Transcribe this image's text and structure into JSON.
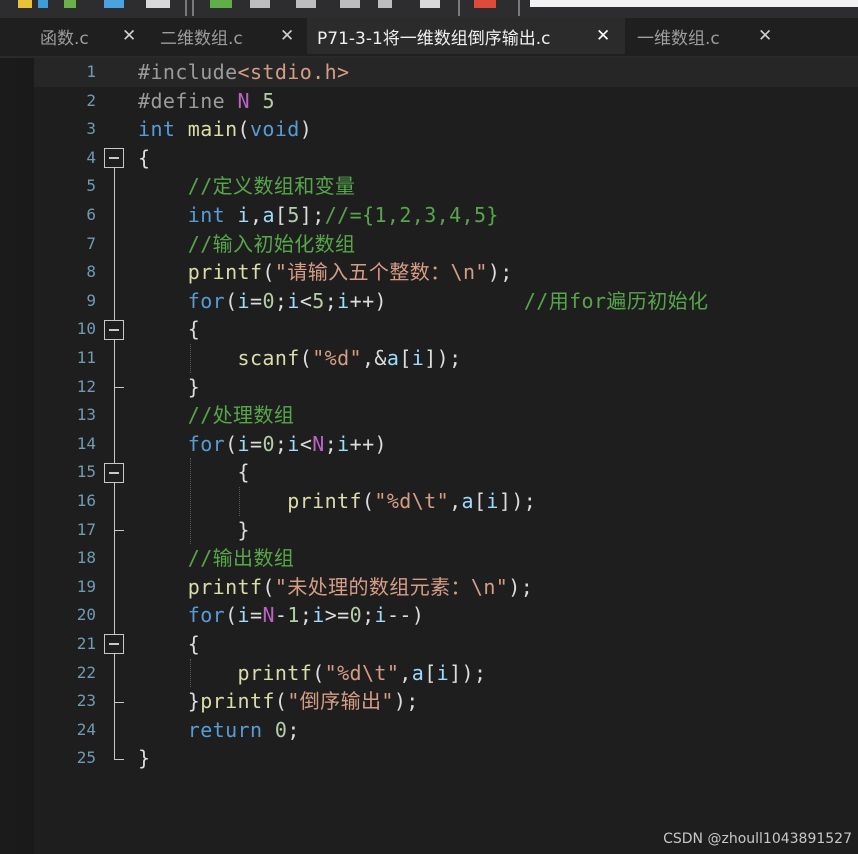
{
  "tabs": [
    {
      "label": "函数.c",
      "close": "✕"
    },
    {
      "label": "二维数组.c",
      "close": "✕"
    },
    {
      "label": "P71-3-1将一维数组倒序输出.c",
      "close": "✕"
    },
    {
      "label": "一维数组.c",
      "close": "✕"
    }
  ],
  "active_tab": 2,
  "code_lines": [
    [
      [
        "pp",
        "#include"
      ],
      [
        "str",
        "<stdio.h>"
      ]
    ],
    [
      [
        "pp",
        "#define "
      ],
      [
        "mac",
        "N"
      ],
      [
        "plain",
        " "
      ],
      [
        "num",
        "5"
      ]
    ],
    [
      [
        "kw",
        "int "
      ],
      [
        "fn",
        "main"
      ],
      [
        "plain",
        "("
      ],
      [
        "kw",
        "void"
      ],
      [
        "plain",
        ")"
      ]
    ],
    [
      [
        "plain",
        "{"
      ]
    ],
    [
      [
        "plain",
        "    "
      ],
      [
        "cmt",
        "//定义数组和变量"
      ]
    ],
    [
      [
        "plain",
        "    "
      ],
      [
        "kw",
        "int "
      ],
      [
        "var",
        "i"
      ],
      [
        "plain",
        ","
      ],
      [
        "var",
        "a"
      ],
      [
        "plain",
        "["
      ],
      [
        "num",
        "5"
      ],
      [
        "plain",
        "];"
      ],
      [
        "cmt",
        "//={1,2,3,4,5}"
      ]
    ],
    [
      [
        "plain",
        "    "
      ],
      [
        "cmt",
        "//输入初始化数组"
      ]
    ],
    [
      [
        "plain",
        "    "
      ],
      [
        "fn",
        "printf"
      ],
      [
        "plain",
        "("
      ],
      [
        "str",
        "\"请输入五个整数：\\n\""
      ],
      [
        "plain",
        ");"
      ]
    ],
    [
      [
        "plain",
        "    "
      ],
      [
        "kw",
        "for"
      ],
      [
        "plain",
        "("
      ],
      [
        "var",
        "i"
      ],
      [
        "plain",
        "="
      ],
      [
        "num",
        "0"
      ],
      [
        "plain",
        ";"
      ],
      [
        "var",
        "i"
      ],
      [
        "plain",
        "<"
      ],
      [
        "num",
        "5"
      ],
      [
        "plain",
        ";"
      ],
      [
        "var",
        "i"
      ],
      [
        "plain",
        "++)           "
      ],
      [
        "cmt",
        "//用for遍历初始化"
      ]
    ],
    [
      [
        "plain",
        "    {"
      ]
    ],
    [
      [
        "plain",
        "        "
      ],
      [
        "fn",
        "scanf"
      ],
      [
        "plain",
        "("
      ],
      [
        "str",
        "\"%d\""
      ],
      [
        "plain",
        ",&"
      ],
      [
        "var",
        "a"
      ],
      [
        "plain",
        "["
      ],
      [
        "var",
        "i"
      ],
      [
        "plain",
        "]);"
      ]
    ],
    [
      [
        "plain",
        "    }"
      ]
    ],
    [
      [
        "plain",
        "    "
      ],
      [
        "cmt",
        "//处理数组"
      ]
    ],
    [
      [
        "plain",
        "    "
      ],
      [
        "kw",
        "for"
      ],
      [
        "plain",
        "("
      ],
      [
        "var",
        "i"
      ],
      [
        "plain",
        "="
      ],
      [
        "num",
        "0"
      ],
      [
        "plain",
        ";"
      ],
      [
        "var",
        "i"
      ],
      [
        "plain",
        "<"
      ],
      [
        "mac",
        "N"
      ],
      [
        "plain",
        ";"
      ],
      [
        "var",
        "i"
      ],
      [
        "plain",
        "++)"
      ]
    ],
    [
      [
        "plain",
        "        {"
      ]
    ],
    [
      [
        "plain",
        "            "
      ],
      [
        "fn",
        "printf"
      ],
      [
        "plain",
        "("
      ],
      [
        "str",
        "\"%d\\t\""
      ],
      [
        "plain",
        ","
      ],
      [
        "var",
        "a"
      ],
      [
        "plain",
        "["
      ],
      [
        "var",
        "i"
      ],
      [
        "plain",
        "]);"
      ]
    ],
    [
      [
        "plain",
        "        }"
      ]
    ],
    [
      [
        "plain",
        "    "
      ],
      [
        "cmt",
        "//输出数组"
      ]
    ],
    [
      [
        "plain",
        "    "
      ],
      [
        "fn",
        "printf"
      ],
      [
        "plain",
        "("
      ],
      [
        "str",
        "\"未处理的数组元素：\\n\""
      ],
      [
        "plain",
        ");"
      ]
    ],
    [
      [
        "plain",
        "    "
      ],
      [
        "kw",
        "for"
      ],
      [
        "plain",
        "("
      ],
      [
        "var",
        "i"
      ],
      [
        "plain",
        "="
      ],
      [
        "mac",
        "N"
      ],
      [
        "plain",
        "-"
      ],
      [
        "num",
        "1"
      ],
      [
        "plain",
        ";"
      ],
      [
        "var",
        "i"
      ],
      [
        "plain",
        ">="
      ],
      [
        "num",
        "0"
      ],
      [
        "plain",
        ";"
      ],
      [
        "var",
        "i"
      ],
      [
        "plain",
        "--)"
      ]
    ],
    [
      [
        "plain",
        "    {"
      ]
    ],
    [
      [
        "plain",
        "        "
      ],
      [
        "fn",
        "printf"
      ],
      [
        "plain",
        "("
      ],
      [
        "str",
        "\"%d\\t\""
      ],
      [
        "plain",
        ","
      ],
      [
        "var",
        "a"
      ],
      [
        "plain",
        "["
      ],
      [
        "var",
        "i"
      ],
      [
        "plain",
        "]);"
      ]
    ],
    [
      [
        "plain",
        "    }"
      ],
      [
        "fn",
        "printf"
      ],
      [
        "plain",
        "("
      ],
      [
        "str",
        "\"倒序输出\""
      ],
      [
        "plain",
        ");"
      ]
    ],
    [
      [
        "plain",
        "    "
      ],
      [
        "kw",
        "return "
      ],
      [
        "num",
        "0"
      ],
      [
        "plain",
        ";"
      ]
    ],
    [
      [
        "plain",
        "}"
      ]
    ]
  ],
  "current_line": 1,
  "fold_lines": [
    4,
    10,
    15,
    21
  ],
  "watermark": "CSDN @zhoull1043891527",
  "colors": {
    "background": "#1e1e1e",
    "keyword": "#569cd6",
    "string": "#d69d85",
    "comment": "#57a64a",
    "preprocessor": "#9b9b9b",
    "macro": "#bd63c5",
    "line_number": "#6f9bb3"
  }
}
